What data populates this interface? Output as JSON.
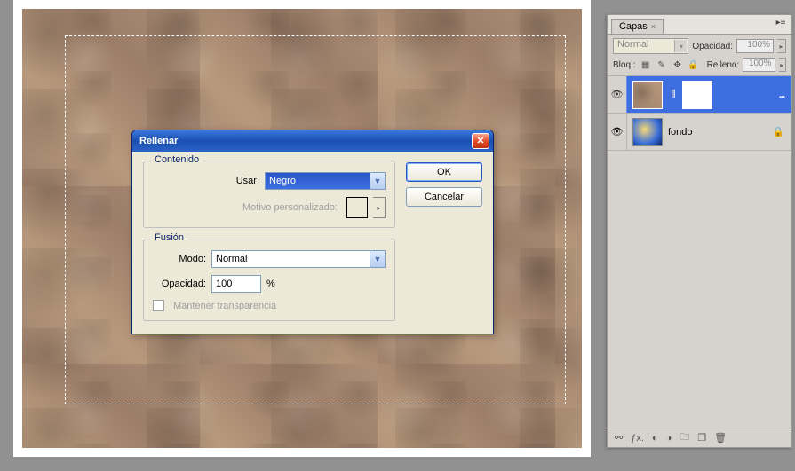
{
  "dialog": {
    "title": "Rellenar",
    "contenido": {
      "legend": "Contenido",
      "usar_label": "Usar:",
      "usar_value": "Negro",
      "motivo_label": "Motivo personalizado:"
    },
    "fusion": {
      "legend": "Fusión",
      "modo_label": "Modo:",
      "modo_value": "Normal",
      "opacidad_label": "Opacidad:",
      "opacidad_value": "100",
      "opacidad_pct": "%",
      "mantener_label": "Mantener transparencia"
    },
    "ok_label": "OK",
    "cancel_label": "Cancelar"
  },
  "panel": {
    "tab": "Capas",
    "blend_mode": "Normal",
    "opacity_label": "Opacidad:",
    "opacity_value": "100%",
    "lock_label": "Bloq.:",
    "fill_label": "Relleno:",
    "fill_value": "100%",
    "layers": [
      {
        "name": "",
        "visible": true,
        "selected": true,
        "has_mask": true,
        "more": "..."
      },
      {
        "name": "fondo",
        "visible": true,
        "selected": false,
        "locked": true
      }
    ]
  }
}
